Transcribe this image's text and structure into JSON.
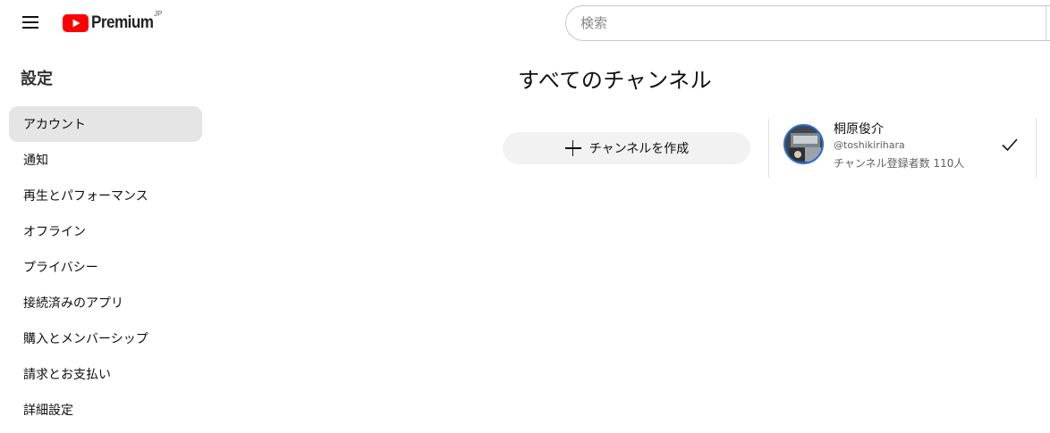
{
  "header": {
    "logo_text": "Premium",
    "logo_country": "JP",
    "search_placeholder": "検索"
  },
  "sidebar": {
    "title": "設定",
    "items": [
      {
        "label": "アカウント",
        "active": true
      },
      {
        "label": "通知"
      },
      {
        "label": "再生とパフォーマンス"
      },
      {
        "label": "オフライン"
      },
      {
        "label": "プライバシー"
      },
      {
        "label": "接続済みのアプリ"
      },
      {
        "label": "購入とメンバーシップ"
      },
      {
        "label": "請求とお支払い"
      },
      {
        "label": "詳細設定"
      }
    ]
  },
  "main": {
    "title": "すべてのチャンネル",
    "create_button_label": "チャンネルを作成",
    "channel": {
      "name": "桐原俊介",
      "handle": "@toshikirihara",
      "subscribers": "チャンネル登録者数 110人",
      "selected": true
    }
  },
  "colors": {
    "brand_red": "#ff0000",
    "active_item_bg": "#e5e5e5",
    "button_bg": "#f2f2f2",
    "avatar_ring": "#2f6fd6"
  }
}
